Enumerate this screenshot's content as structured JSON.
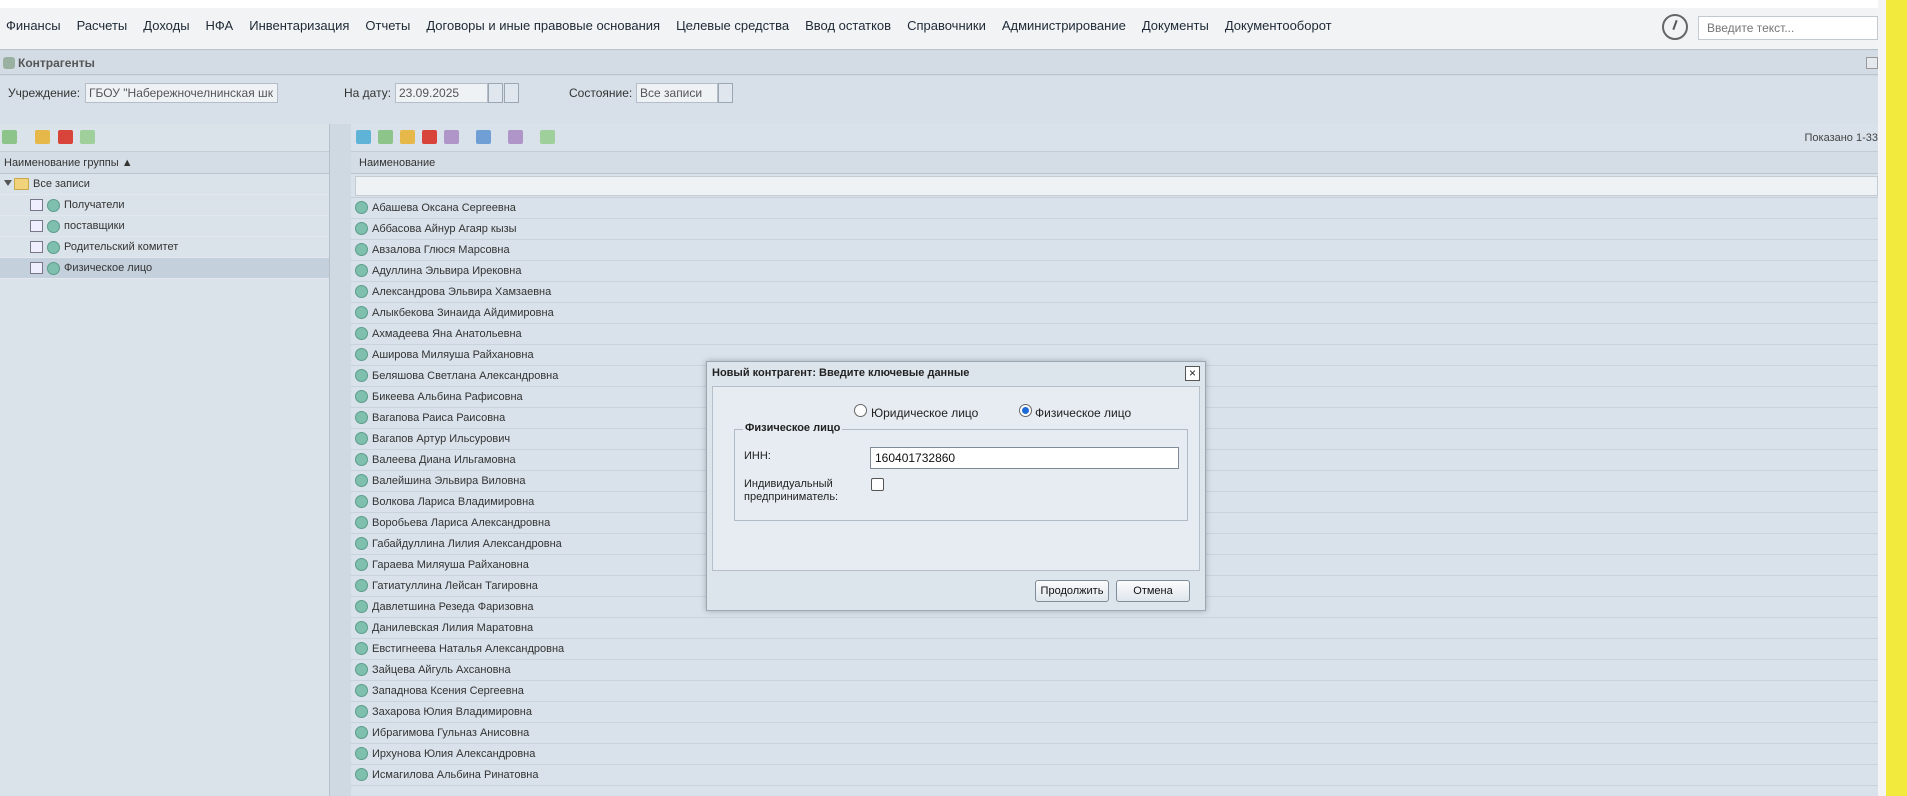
{
  "menu": [
    "Финансы",
    "Расчеты",
    "Доходы",
    "НФА",
    "Инвентаризация",
    "Отчеты",
    "Договоры и иные правовые основания",
    "Целевые средства",
    "Ввод остатков",
    "Справочники",
    "Администрирование",
    "Документы",
    "Документооборот"
  ],
  "search": {
    "placeholder": "Введите текст..."
  },
  "panel": {
    "title": "Контрагенты"
  },
  "filters": {
    "institution_label": "Учреждение:",
    "institution_value": "ГБОУ \"Набережночелнинская шк",
    "date_label": "На дату:",
    "date_value": "23.09.2025",
    "state_label": "Состояние:",
    "state_value": "Все записи"
  },
  "tree": {
    "header": "Наименование группы ▲",
    "root": "Все записи",
    "items": [
      "Получатели",
      "поставщики",
      "Родительский комитет",
      "Физическое лицо"
    ],
    "selected_index": 3
  },
  "grid": {
    "header": "Наименование",
    "shown": "Показано 1-33",
    "rows": [
      "Абашева Оксана Сергеевна",
      "Аббасова Айнур Агаяр кызы",
      "Авзалова Глюся Марсовна",
      "Адуллина Эльвира Ирековна",
      "Александрова Эльвира Хамзаевна",
      "Алыкбекова Зинаида Айдимировна",
      "Ахмадеева Яна Анатольевна",
      "Аширова Миляуша Райхановна",
      "Беляшова Светлана Александровна",
      "Бикеева Альбина Рафисовна",
      "Вагапова Раиса Раисовна",
      "Вагапов Артур Ильсурович",
      "Валеева Диана Ильгамовна",
      "Валейшина Эльвира Виловна",
      "Волкова Лариса Владимировна",
      "Воробьева Лариса Александровна",
      "Габайдуллина Лилия Александровна",
      "Гараева Миляуша Райхановна",
      "Гатиатуллина Лейсан Тагировна",
      "Давлетшина Резеда Фаризовна",
      "Данилевская Лилия Маратовна",
      "Евстигнеева Наталья Александровна",
      "Зайцева Айгуль Ахсановна",
      "Западнова Ксения Сергеевна",
      "Захарова Юлия Владимировна",
      "Ибрагимова Гульназ Анисовна",
      "Ирхунова Юлия Александровна",
      "Исмагилова Альбина Ринатовна"
    ]
  },
  "dialog": {
    "title": "Новый контрагент: Введите ключевые данные",
    "radio_legal": "Юридическое лицо",
    "radio_individual": "Физическое лицо",
    "fieldset_legend": "Физическое лицо",
    "inn_label": "ИНН:",
    "inn_value": "160401732860",
    "ip_label_1": "Индивидуальный",
    "ip_label_2": "предприниматель:",
    "continue_button": "Продолжить",
    "cancel_button": "Отмена",
    "close_glyph": "×"
  },
  "colors": {
    "accent_yellow": "#f2ea3d",
    "radio_selected": "#1e6ad6"
  }
}
